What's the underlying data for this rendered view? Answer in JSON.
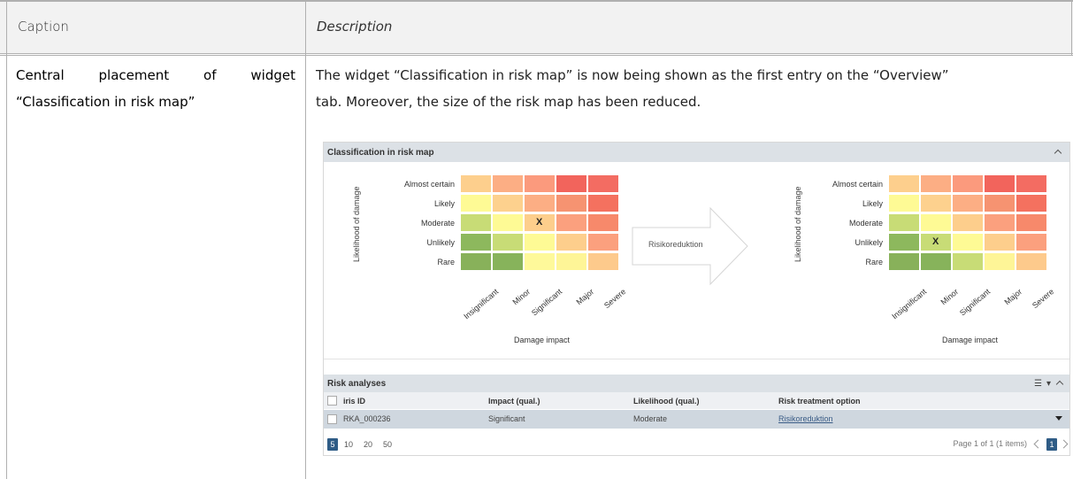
{
  "doc": {
    "header_caption": "Caption",
    "header_description": "Description",
    "caption_line1_words": [
      "Central",
      "placement",
      "of",
      "widget"
    ],
    "caption_line2": "“Classification in risk map”",
    "description_line1": "The widget “Classification in risk map” is now being shown as the first entry on the “Overview”",
    "description_line2": "tab. Moreover, the size of the risk map has been reduced."
  },
  "widget": {
    "title": "Classification in risk map",
    "y_axis_title": "Likelihood of damage",
    "x_axis_title": "Damage impact",
    "rows": [
      "Almost certain",
      "Likely",
      "Moderate",
      "Unlikely",
      "Rare"
    ],
    "cols": [
      "Insignificant",
      "Minor",
      "Significant",
      "Major",
      "Severe"
    ],
    "arrow_label": "Risikoreduktion",
    "mark": "X",
    "before_mark": {
      "row": 2,
      "col": 2
    },
    "after_mark": {
      "row": 3,
      "col": 1
    },
    "colors_before": [
      [
        "#fdcf8d",
        "#fcae84",
        "#fb9a7d",
        "#f2645c",
        "#f36c62"
      ],
      [
        "#fefa95",
        "#fdd18e",
        "#fcae84",
        "#f69371",
        "#f4715f"
      ],
      [
        "#c8dc76",
        "#fefa95",
        "#fdce8c",
        "#fba07e",
        "#f7896b"
      ],
      [
        "#8db85d",
        "#c8dc76",
        "#fefa95",
        "#fdce8c",
        "#fba07e"
      ],
      [
        "#88b15a",
        "#87b35b",
        "#fef99a",
        "#fef597",
        "#fdca8c"
      ]
    ],
    "colors_after": [
      [
        "#fdcf8d",
        "#fcae84",
        "#fb9a7d",
        "#f2645c",
        "#f36c62"
      ],
      [
        "#fefa95",
        "#fdd18e",
        "#fcae84",
        "#f69371",
        "#f4715f"
      ],
      [
        "#c8dc76",
        "#fefa95",
        "#fdce8c",
        "#fba07e",
        "#f7896b"
      ],
      [
        "#8db85d",
        "#c8dc76",
        "#fefa95",
        "#fdce8c",
        "#fba07e"
      ],
      [
        "#88b15a",
        "#87b35b",
        "#c8dc76",
        "#fef597",
        "#fdca8c"
      ]
    ]
  },
  "risk_analyses": {
    "title": "Risk analyses",
    "columns": [
      "iris ID",
      "Impact (qual.)",
      "Likelihood (qual.)",
      "Risk treatment option"
    ],
    "rows": [
      {
        "id": "RKA_000236",
        "impact": "Significant",
        "likelihood": "Moderate",
        "treatment": "Risikoreduktion"
      }
    ],
    "page_sizes": [
      "5",
      "10",
      "20",
      "50"
    ],
    "active_page_size": "5",
    "page_info": "Page 1 of 1 (1 items)",
    "current_page": "1"
  }
}
